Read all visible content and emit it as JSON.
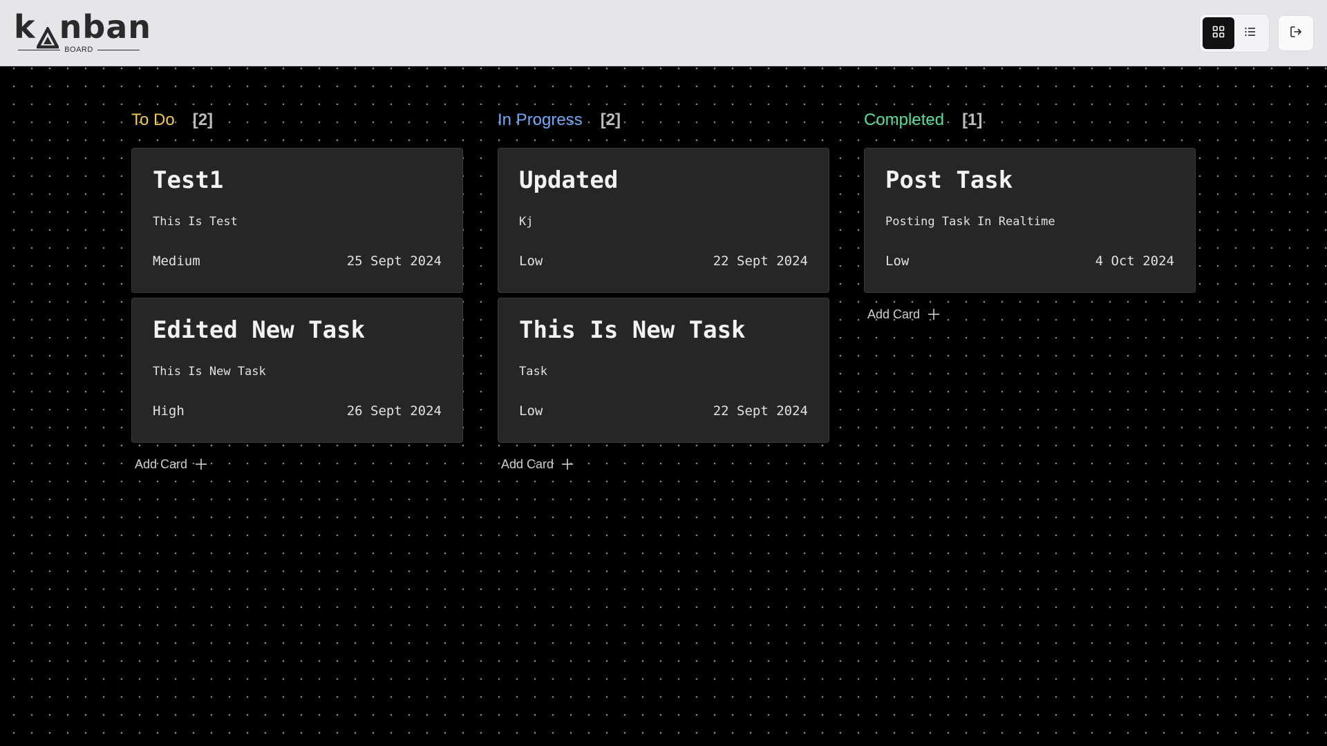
{
  "app": {
    "logo_text": "kanban",
    "logo_subtitle": "BOARD"
  },
  "toolbar": {
    "grid_view_icon": "grid-icon",
    "list_view_icon": "list-icon",
    "logout_icon": "logout-icon",
    "active_view": "grid"
  },
  "colors": {
    "todo": "#f2c94c",
    "in_progress": "#6fa8f5",
    "completed": "#55e09a"
  },
  "columns": [
    {
      "title": "To Do",
      "count": "[2]",
      "add_label": "Add Card",
      "cards": [
        {
          "title": "Test1",
          "description": "This Is Test",
          "priority": "Medium",
          "date": "25 Sept 2024"
        },
        {
          "title": "Edited New Task",
          "description": "This Is New Task",
          "priority": "High",
          "date": "26 Sept 2024"
        }
      ]
    },
    {
      "title": "In Progress",
      "count": "[2]",
      "add_label": "Add Card",
      "cards": [
        {
          "title": "Updated",
          "description": "Kj",
          "priority": "Low",
          "date": "22 Sept 2024"
        },
        {
          "title": "This Is New Task",
          "description": "Task",
          "priority": "Low",
          "date": "22 Sept 2024"
        }
      ]
    },
    {
      "title": "Completed",
      "count": "[1]",
      "add_label": "Add Card",
      "cards": [
        {
          "title": "Post Task",
          "description": "Posting Task In Realtime",
          "priority": "Low",
          "date": "4 Oct 2024"
        }
      ]
    }
  ]
}
